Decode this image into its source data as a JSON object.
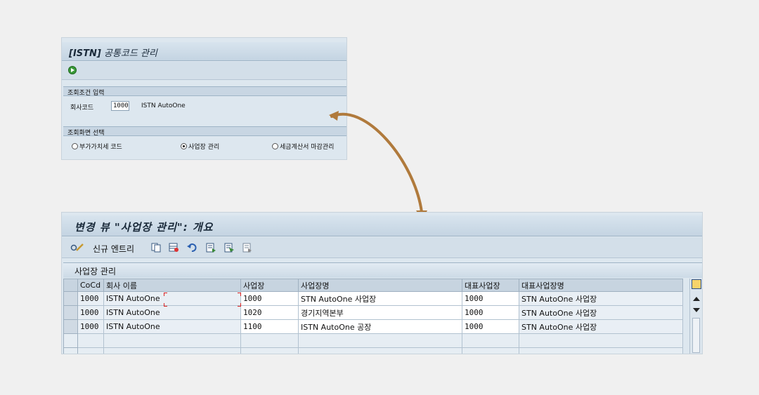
{
  "panel1": {
    "title_prefix": "[ISTN]",
    "title_rest": " 공통코드 관리",
    "section1": {
      "header": "조회조건 입력",
      "company_code_label": "회사코드",
      "company_code_value": "1000",
      "company_name": "ISTN AutoOne"
    },
    "section2": {
      "header": "조회화면 선택",
      "options": [
        {
          "label": "부가가치세 코드",
          "selected": false
        },
        {
          "label": "사업장 관리",
          "selected": true
        },
        {
          "label": "세금계산서 마감관리",
          "selected": false
        }
      ]
    }
  },
  "panel2": {
    "title": "변경 뷰 \"사업장 관리\": 개요",
    "toolbar": {
      "new_entries_label": "신규 엔트리"
    },
    "section_title": "사업장 관리",
    "columns": [
      "CoCd",
      "회사 이름",
      "사업장",
      "사업장명",
      "대표사업장",
      "대표사업장명"
    ],
    "rows": [
      [
        "1000",
        "ISTN AutoOne",
        "1000",
        "STN AutoOne 사업장",
        "1000",
        "STN AutoOne 사업장"
      ],
      [
        "1000",
        "ISTN AutoOne",
        "1020",
        "경기지역본부",
        "1000",
        "STN AutoOne 사업장"
      ],
      [
        "1000",
        "ISTN AutoOne",
        "1100",
        "ISTN AutoOne 공장",
        "1000",
        "STN AutoOne 사업장"
      ]
    ]
  },
  "colors": {
    "arrow": "#b07a3c",
    "panel_bg": "#dde7ef",
    "header_bg": "#c7d4e0"
  }
}
